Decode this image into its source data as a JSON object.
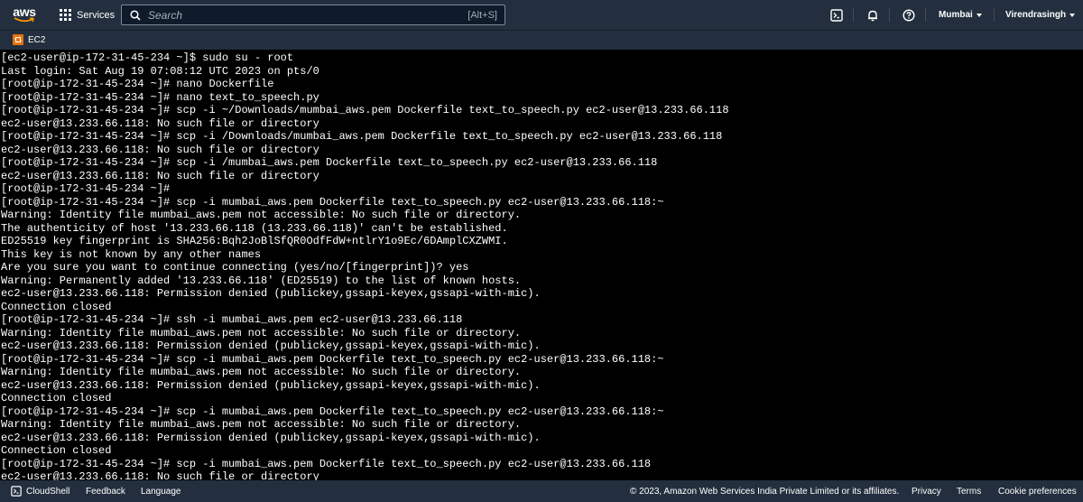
{
  "header": {
    "logo_text": "aws",
    "services_label": "Services",
    "search_placeholder": "Search",
    "search_shortcut": "[Alt+S]",
    "region": "Mumbai",
    "user": "Virendrasingh",
    "icons": [
      "cloudshell-icon",
      "bell-icon",
      "help-icon"
    ]
  },
  "subbar": {
    "favorite_label": "EC2"
  },
  "terminal": {
    "lines": [
      "[ec2-user@ip-172-31-45-234 ~]$ sudo su - root",
      "Last login: Sat Aug 19 07:08:12 UTC 2023 on pts/0",
      "[root@ip-172-31-45-234 ~]# nano Dockerfile",
      "[root@ip-172-31-45-234 ~]# nano text_to_speech.py",
      "[root@ip-172-31-45-234 ~]# scp -i ~/Downloads/mumbai_aws.pem Dockerfile text_to_speech.py ec2-user@13.233.66.118",
      "ec2-user@13.233.66.118: No such file or directory",
      "[root@ip-172-31-45-234 ~]# scp -i /Downloads/mumbai_aws.pem Dockerfile text_to_speech.py ec2-user@13.233.66.118",
      "ec2-user@13.233.66.118: No such file or directory",
      "[root@ip-172-31-45-234 ~]# scp -i /mumbai_aws.pem Dockerfile text_to_speech.py ec2-user@13.233.66.118",
      "ec2-user@13.233.66.118: No such file or directory",
      "[root@ip-172-31-45-234 ~]#",
      "[root@ip-172-31-45-234 ~]# scp -i mumbai_aws.pem Dockerfile text_to_speech.py ec2-user@13.233.66.118:~",
      "Warning: Identity file mumbai_aws.pem not accessible: No such file or directory.",
      "The authenticity of host '13.233.66.118 (13.233.66.118)' can't be established.",
      "ED25519 key fingerprint is SHA256:Bqh2JoBlSfQR0OdfFdW+ntlrY1o9Ec/6DAmplCXZWMI.",
      "This key is not known by any other names",
      "Are you sure you want to continue connecting (yes/no/[fingerprint])? yes",
      "Warning: Permanently added '13.233.66.118' (ED25519) to the list of known hosts.",
      "ec2-user@13.233.66.118: Permission denied (publickey,gssapi-keyex,gssapi-with-mic).",
      "Connection closed",
      "[root@ip-172-31-45-234 ~]# ssh -i mumbai_aws.pem ec2-user@13.233.66.118",
      "Warning: Identity file mumbai_aws.pem not accessible: No such file or directory.",
      "ec2-user@13.233.66.118: Permission denied (publickey,gssapi-keyex,gssapi-with-mic).",
      "[root@ip-172-31-45-234 ~]# scp -i mumbai_aws.pem Dockerfile text_to_speech.py ec2-user@13.233.66.118:~",
      "Warning: Identity file mumbai_aws.pem not accessible: No such file or directory.",
      "ec2-user@13.233.66.118: Permission denied (publickey,gssapi-keyex,gssapi-with-mic).",
      "Connection closed",
      "[root@ip-172-31-45-234 ~]# scp -i mumbai_aws.pem Dockerfile text_to_speech.py ec2-user@13.233.66.118:~",
      "Warning: Identity file mumbai_aws.pem not accessible: No such file or directory.",
      "ec2-user@13.233.66.118: Permission denied (publickey,gssapi-keyex,gssapi-with-mic).",
      "Connection closed",
      "[root@ip-172-31-45-234 ~]# scp -i mumbai_aws.pem Dockerfile text_to_speech.py ec2-user@13.233.66.118",
      "ec2-user@13.233.66.118: No such file or directory"
    ]
  },
  "footer": {
    "cloudshell": "CloudShell",
    "feedback": "Feedback",
    "language": "Language",
    "copyright": "© 2023, Amazon Web Services India Private Limited or its affiliates.",
    "privacy": "Privacy",
    "terms": "Terms",
    "cookies": "Cookie preferences"
  },
  "colors": {
    "nav_bg": "#232f3e",
    "terminal_bg": "#000000",
    "terminal_fg": "#ffffff",
    "aws_smile": "#ff9900",
    "ec2_orange": "#e8730f"
  }
}
